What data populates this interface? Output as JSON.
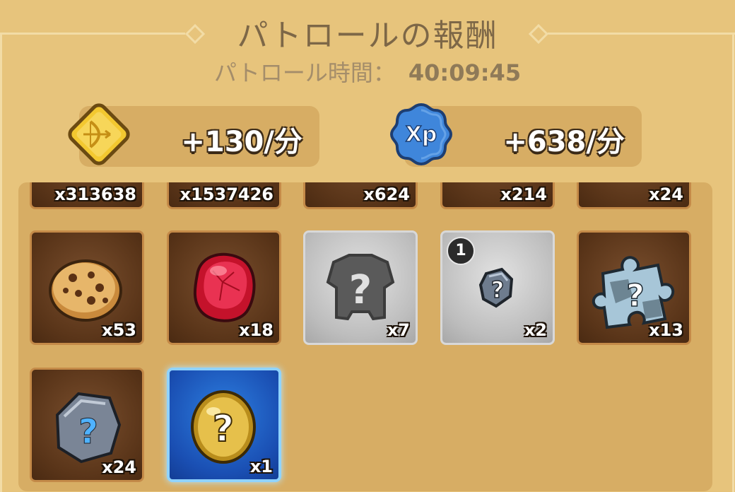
{
  "header": {
    "title": "パトロールの報酬",
    "subtitle_label": "パトロール時間：",
    "patrol_time": "40:09:45"
  },
  "rates": [
    {
      "icon": "bow-rune-icon",
      "text": "+130/分"
    },
    {
      "icon": "xp-badge-icon",
      "text": "+638/分"
    }
  ],
  "rewards_top_row": [
    {
      "count": "x313638"
    },
    {
      "count": "x1537426"
    },
    {
      "count": "x624"
    },
    {
      "count": "x214"
    },
    {
      "count": "x24"
    }
  ],
  "rewards": [
    {
      "name": "cookie",
      "count": "x53",
      "style": "brown"
    },
    {
      "name": "red-gem",
      "count": "x18",
      "style": "brown"
    },
    {
      "name": "mystery-armor",
      "count": "x7",
      "style": "gray"
    },
    {
      "name": "mystery-stone",
      "count": "x2",
      "style": "gray",
      "badge": "1"
    },
    {
      "name": "mystery-puzzle",
      "count": "x13",
      "style": "brown"
    },
    {
      "name": "mystery-rock",
      "count": "x24",
      "style": "brown"
    },
    {
      "name": "mystery-egg",
      "count": "x1",
      "style": "blue"
    }
  ],
  "colors": {
    "panel": "#e7c47c",
    "title": "#7d6747",
    "rate_box": "#d7ad64"
  }
}
